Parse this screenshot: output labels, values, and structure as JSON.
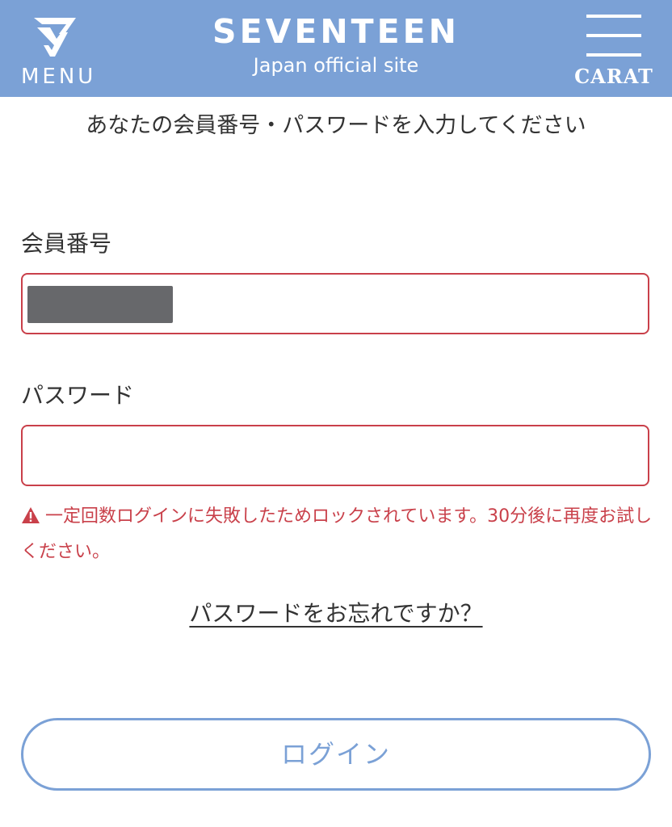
{
  "header": {
    "menu_label": "MENU",
    "brand_title": "SEVENTEEN",
    "brand_subtitle": "Japan official site",
    "carat_label": "CARAT",
    "logo_icon": "seventeen-logo-icon",
    "menu_icon": "hamburger-icon",
    "background_color": "#7ba1d6"
  },
  "form": {
    "instruction": "あなたの会員番号・パスワードを入力してください",
    "member_number": {
      "label": "会員番号",
      "value": "",
      "redacted": true
    },
    "password": {
      "label": "パスワード",
      "value": ""
    },
    "error": {
      "icon": "warning-icon",
      "message": "一定回数ログインに失敗したためロックされています。30分後に再度お試しください。",
      "color": "#c9404a"
    },
    "forgot_password_link": "パスワードをお忘れですか？",
    "login_button": "ログイン"
  }
}
